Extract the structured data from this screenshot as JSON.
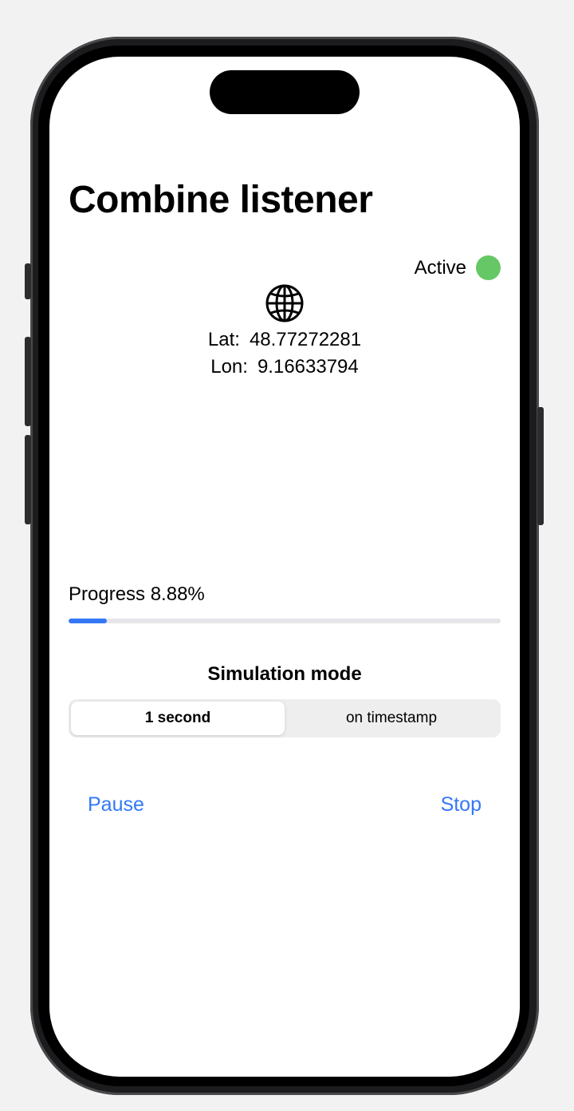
{
  "app": {
    "title": "Combine listener"
  },
  "status": {
    "label": "Active",
    "dot_color": "#66c766"
  },
  "location": {
    "icon": "globe-icon",
    "lat_label": "Lat:",
    "lat_value": "48.77272281",
    "lon_label": "Lon:",
    "lon_value": "9.16633794"
  },
  "progress": {
    "label": "Progress 8.88%",
    "fraction": 0.0888,
    "accent": "#3478f6"
  },
  "simulation": {
    "title": "Simulation mode",
    "options": [
      "1 second",
      "on timestamp"
    ],
    "selected": "1 second"
  },
  "actions": {
    "pause_label": "Pause",
    "stop_label": "Stop"
  }
}
